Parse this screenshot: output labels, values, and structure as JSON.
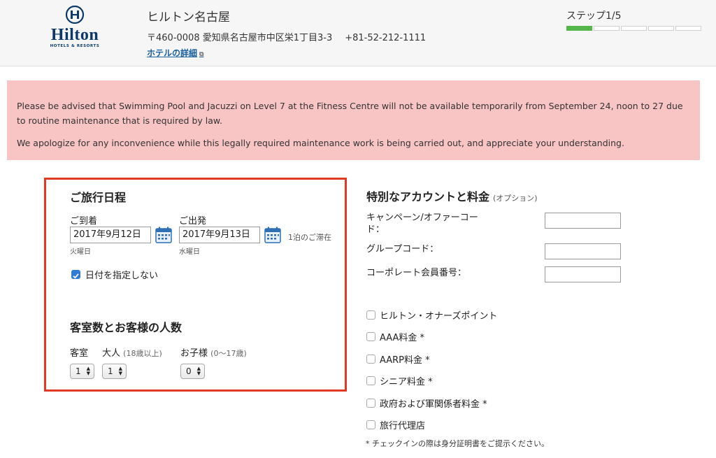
{
  "header": {
    "logo_word": "Hilton",
    "logo_tagline": "HOTELS & RESORTS",
    "hotel_name": "ヒルトン名古屋",
    "address": "〒460-0008 愛知県名古屋市中区栄1丁目3-3",
    "phone": "+81-52-212-1111",
    "details_link": "ホテルの詳細",
    "step_label": "ステップ1/5",
    "step_current": 1,
    "step_total": 5,
    "colors": {
      "step_done": "#55b64c",
      "link": "#1a5f9e",
      "brand": "#0b3a6a"
    }
  },
  "notice": {
    "line1": "Please be advised that Swimming Pool and Jacuzzi on Level 7 at the Fitness Centre will not be available temporarily from September 24, noon to 27 due to routine maintenance that is required by law.",
    "line2": "We apologize for any inconvenience while this legally required maintenance work is being carried out, and appreciate your understanding.",
    "background": "#f8c4c4"
  },
  "itinerary": {
    "title": "ご旅行日程",
    "arrival_label": "ご到着",
    "arrival_value": "2017年9月12日",
    "arrival_dow": "火曜日",
    "departure_label": "ご出発",
    "departure_value": "2017年9月13日",
    "departure_dow": "水曜日",
    "nights": "1泊のご滞在",
    "no_dates_label": "日付を指定しない",
    "no_dates_checked": true,
    "highlight_color": "#e03a24"
  },
  "rooms": {
    "title": "客室数とお客様の人数",
    "rooms_label": "客室",
    "adults_label": "大人",
    "adults_note": "(18歳以上)",
    "children_label": "お子様",
    "children_note": "(0〜17歳)",
    "rooms_value": "1",
    "adults_value": "1",
    "children_value": "0"
  },
  "special": {
    "title": "特別なアカウントと料金",
    "optional": "(オプション)",
    "campaign_label_1": "キャンペーン/オファーコー",
    "campaign_label_2": "ド：",
    "group_label": "グループコード：",
    "corporate_label": "コーポレート会員番号：",
    "rates": [
      "ヒルトン・オナーズポイント",
      "AAA料金 *",
      "AARP料金 *",
      "シニア料金 *",
      "政府および軍関係者料金 *",
      "旅行代理店"
    ],
    "footnote": "* チェックインの際は身分証明書をご提示ください。"
  }
}
